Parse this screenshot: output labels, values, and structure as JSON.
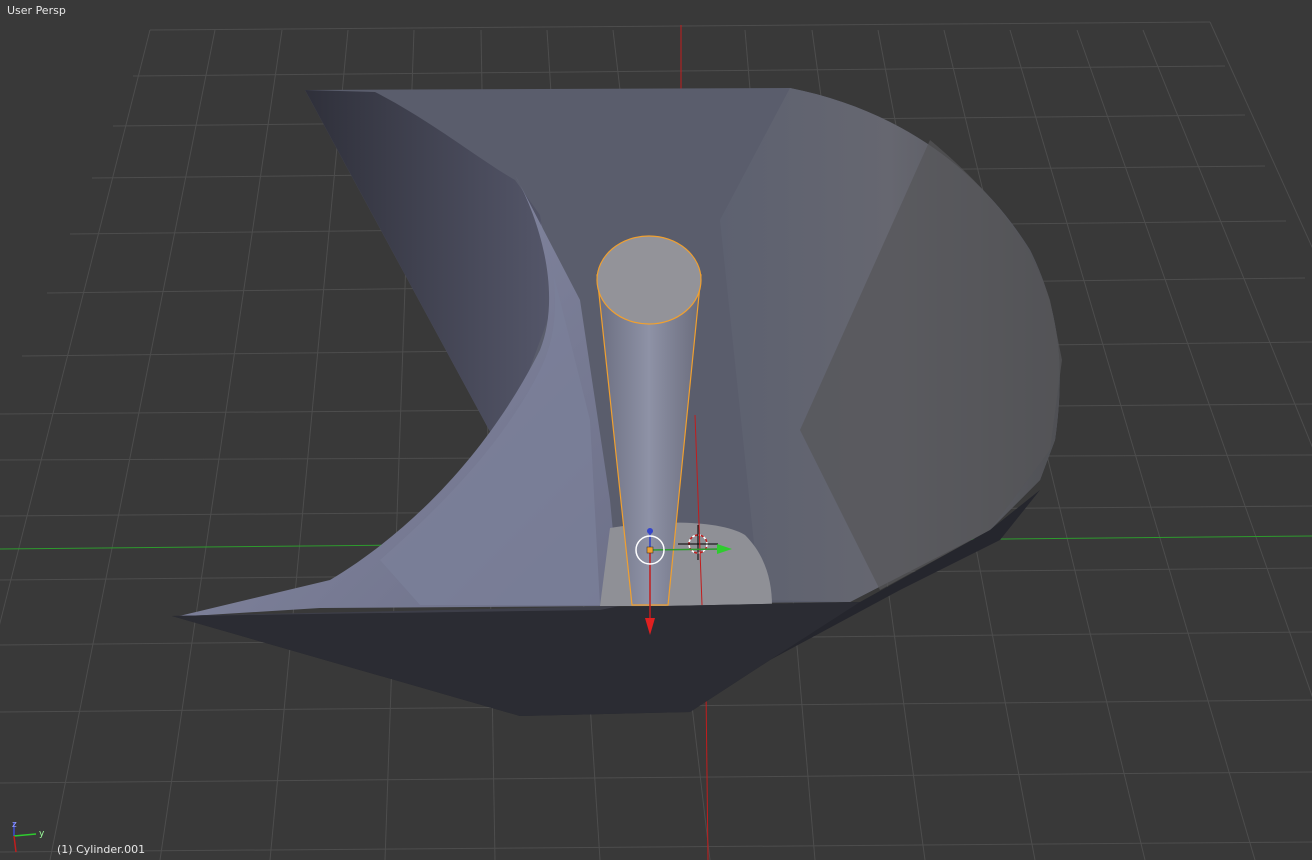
{
  "viewport": {
    "view_label": "User Persp",
    "active_object_label": "(1) Cylinder.001",
    "background_color": "#393939",
    "grid_color": "#4d4d4d",
    "x_axis_color": "#c21d1d",
    "y_axis_color": "#2e9a2e",
    "selection_outline_color": "#f0a030"
  },
  "axis_gizmo": {
    "z_label": "z",
    "y_label": "y"
  },
  "icons": {
    "manipulator": "transform-manipulator-icon",
    "cursor": "3d-cursor-icon",
    "origin": "object-origin-icon",
    "axis_gizmo": "view-axis-gizmo-icon"
  }
}
